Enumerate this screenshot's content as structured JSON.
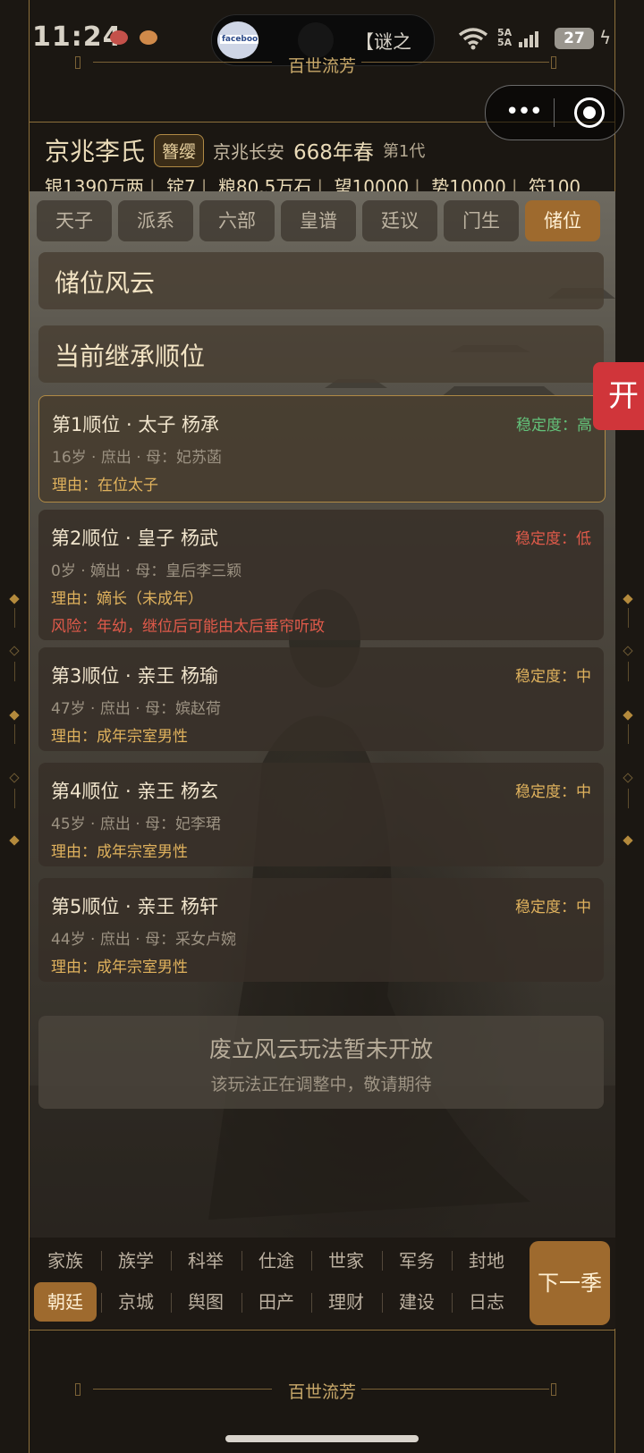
{
  "status_bar": {
    "time": "11:24",
    "island_text": "【谜之",
    "island_thumb_label": "facebook",
    "network": "5A\n5A",
    "battery": "27"
  },
  "brand": {
    "top": "百世流芳",
    "bottom": "百世流芳"
  },
  "header": {
    "clan_name": "京兆李氏",
    "clan_tag": "簪缨",
    "location": "京兆长安",
    "year": "668年春",
    "generation": "第1代",
    "resources": [
      "银1390万两",
      "锭7",
      "粮80.5万石",
      "望10000",
      "势10000",
      "符100"
    ]
  },
  "tabs": [
    {
      "label": "天子"
    },
    {
      "label": "派系"
    },
    {
      "label": "六部"
    },
    {
      "label": "皇谱"
    },
    {
      "label": "廷议"
    },
    {
      "label": "门生"
    },
    {
      "label": "储位"
    }
  ],
  "sections": {
    "title": "储位风云",
    "subtitle": "当前继承顺位"
  },
  "heirs": [
    {
      "title": "第1顺位 · 太子 杨承",
      "stability": "稳定度：高",
      "meta": "16岁 · 庶出 · 母：妃苏菡",
      "reason": "理由：在位太子",
      "risk": ""
    },
    {
      "title": "第2顺位 · 皇子 杨武",
      "stability": "稳定度：低",
      "meta": "0岁 · 嫡出 · 母：皇后李三颖",
      "reason": "理由：嫡长（未成年）",
      "risk": "风险：年幼，继位后可能由太后垂帘听政"
    },
    {
      "title": "第3顺位 · 亲王 杨瑜",
      "stability": "稳定度：中",
      "meta": "47岁 · 庶出 · 母：嫔赵荷",
      "reason": "理由：成年宗室男性",
      "risk": ""
    },
    {
      "title": "第4顺位 · 亲王 杨玄",
      "stability": "稳定度：中",
      "meta": "45岁 · 庶出 · 母：妃李珺",
      "reason": "理由：成年宗室男性",
      "risk": ""
    },
    {
      "title": "第5顺位 · 亲王 杨轩",
      "stability": "稳定度：中",
      "meta": "44岁 · 庶出 · 母：采女卢婉",
      "reason": "理由：成年宗室男性",
      "risk": ""
    }
  ],
  "locked": {
    "title": "废立风云玩法暂未开放",
    "subtitle": "该玩法正在调整中，敬请期待"
  },
  "side_button": "开",
  "capsule": {
    "more_icon": "more-dots-icon",
    "close_icon": "target-close-icon"
  },
  "bottom_nav": {
    "row1": [
      "家族",
      "族学",
      "科举",
      "仕途",
      "世家",
      "军务",
      "封地"
    ],
    "row2": [
      "朝廷",
      "京城",
      "舆图",
      "田产",
      "理财",
      "建设",
      "日志"
    ],
    "active": "朝廷",
    "next_label": "下一季"
  },
  "colors": {
    "accent": "#9e6a2e",
    "stability_high": "#63c27a",
    "stability_low": "#e05a4a",
    "stability_mid": "#e0b25d"
  }
}
